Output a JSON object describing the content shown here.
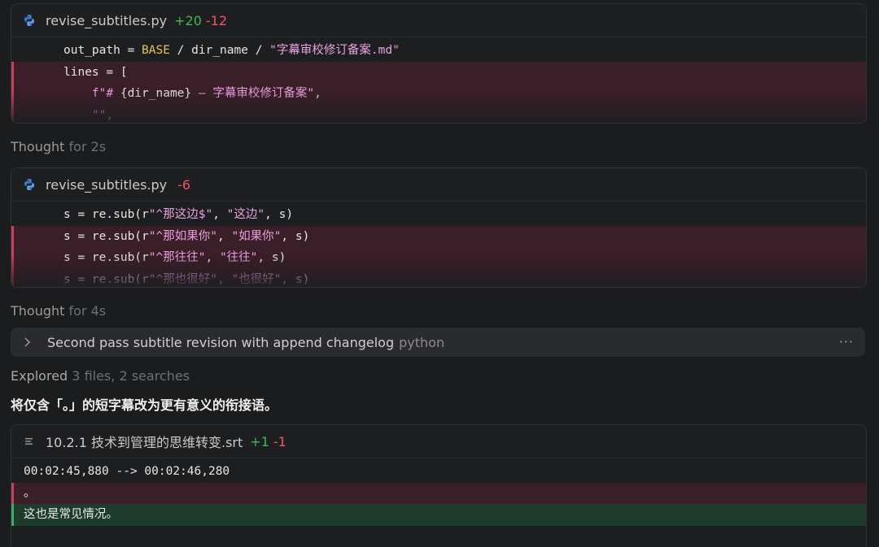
{
  "diff1": {
    "filename": "revise_subtitles.py",
    "added": "+20",
    "removed": "-12",
    "icon": "python-icon",
    "lines": [
      {
        "type": "plain",
        "parts": [
          {
            "t": "out_path = "
          },
          {
            "t": "BASE",
            "c": "kw"
          },
          {
            "t": " / dir_name / "
          },
          {
            "t": "\"字幕审校修订备案.md\"",
            "c": "str"
          }
        ]
      },
      {
        "type": "del",
        "parts": [
          {
            "t": "lines = ["
          }
        ]
      },
      {
        "type": "del",
        "parts": [
          {
            "t": "    "
          },
          {
            "t": "f\"# ",
            "c": "str"
          },
          {
            "t": "{dir_name}"
          },
          {
            "t": " — 字幕审校修订备案\"",
            "c": "str"
          },
          {
            "t": ","
          }
        ]
      },
      {
        "type": "del",
        "parts": [
          {
            "t": "    "
          },
          {
            "t": "\"\"",
            "c": "str"
          },
          {
            "t": ","
          }
        ]
      }
    ]
  },
  "thought1": {
    "label": "Thought",
    "duration": "for 2s"
  },
  "diff2": {
    "filename": "revise_subtitles.py",
    "added": "",
    "removed": "-6",
    "icon": "python-icon",
    "lines": [
      {
        "type": "plain",
        "parts": [
          {
            "t": "s = re.sub(r"
          },
          {
            "t": "\"^那这边$\"",
            "c": "str"
          },
          {
            "t": ", "
          },
          {
            "t": "\"这边\"",
            "c": "str"
          },
          {
            "t": ", s)"
          }
        ]
      },
      {
        "type": "del",
        "parts": [
          {
            "t": "s = re.sub(r"
          },
          {
            "t": "\"^那如果你\"",
            "c": "str"
          },
          {
            "t": ", "
          },
          {
            "t": "\"如果你\"",
            "c": "str"
          },
          {
            "t": ", s)"
          }
        ]
      },
      {
        "type": "del",
        "parts": [
          {
            "t": "s = re.sub(r"
          },
          {
            "t": "\"^那往往\"",
            "c": "str"
          },
          {
            "t": ", "
          },
          {
            "t": "\"往往\"",
            "c": "str"
          },
          {
            "t": ", s)"
          }
        ]
      },
      {
        "type": "del",
        "parts": [
          {
            "t": "s = re.sub(r"
          },
          {
            "t": "\"^那也很好\"",
            "c": "str"
          },
          {
            "t": ", "
          },
          {
            "t": "\"也很好\"",
            "c": "str"
          },
          {
            "t": ", s)"
          }
        ]
      }
    ]
  },
  "thought2": {
    "label": "Thought",
    "duration": "for 4s"
  },
  "run": {
    "title": "Second pass subtitle revision with append changelog",
    "lang": "python",
    "more": "···"
  },
  "explored": {
    "label": "Explored",
    "detail": "3 files, 2 searches"
  },
  "message": "将仅含「。」的短字幕改为更有意义的衔接语。",
  "diff3": {
    "filename": "10.2.1 技术到管理的思维转变.srt",
    "added": "+1",
    "removed": "-1",
    "icon": "text-lines-icon",
    "lines": [
      {
        "type": "plain",
        "parts": [
          {
            "t": "00:02:45,880 --> 00:02:46,280"
          }
        ]
      },
      {
        "type": "del",
        "parts": [
          {
            "t": "。"
          }
        ]
      },
      {
        "type": "add",
        "parts": [
          {
            "t": "这也是常见情况。"
          }
        ]
      }
    ]
  },
  "colors": {
    "background": "#1b1c1e",
    "added": "#3fb950",
    "removed": "#f05368",
    "del_bg": "#3a1e28",
    "add_bg": "#1e3c2c"
  }
}
